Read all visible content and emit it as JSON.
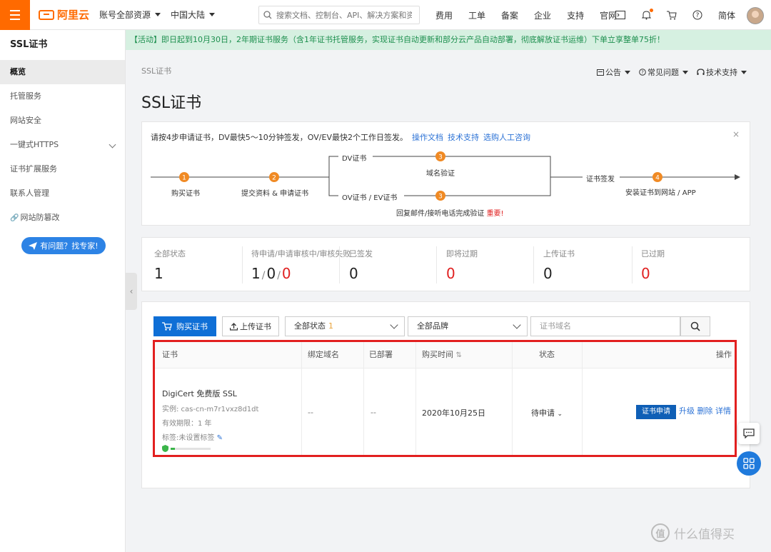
{
  "topbar": {
    "logo_text": "阿里云",
    "account_scope": "账号全部资源",
    "region": "中国大陆",
    "search_placeholder": "搜索文档、控制台、API、解决方案和资源",
    "links": [
      "费用",
      "工单",
      "备案",
      "企业",
      "支持",
      "官网"
    ],
    "lang": "简体"
  },
  "banner": "【活动】即日起到10月30日，2年期证书服务（含1年证书托管服务，实现证书自动更新和部分云产品自动部署，彻底解放证书运维）下单立享整单75折！",
  "sidebar": {
    "title": "SSL证书",
    "items": [
      {
        "label": "概览",
        "active": true
      },
      {
        "label": "托管服务"
      },
      {
        "label": "网站安全"
      },
      {
        "label": "一键式HTTPS",
        "expandable": true
      },
      {
        "label": "证书扩展服务"
      },
      {
        "label": "联系人管理"
      },
      {
        "label": "网站防篡改",
        "icon": "link-icon"
      }
    ],
    "help_button": "有问题？找专家!"
  },
  "breadcrumb": "SSL证书",
  "page_title": "SSL证书",
  "header_links": [
    "公告",
    "常见问题",
    "技术支持"
  ],
  "steps": {
    "tip_text": "请按4步申请证书，DV最快5～10分钟签发，OV/EV最快2个工作日签发。",
    "tip_links": [
      "操作文档",
      "技术支持",
      "选购人工咨询"
    ],
    "labels": {
      "s1": "购买证书",
      "s2": "提交资料 & 申请证书",
      "dv": "DV证书",
      "ov": "OV证书 / EV证书",
      "s3": "域名验证",
      "s3b": "回复邮件/接听电话完成验证",
      "important": "重要!",
      "issue": "证书签发",
      "s4": "安装证书到网站 / APP"
    },
    "numbers": [
      "1",
      "2",
      "3",
      "3",
      "4"
    ]
  },
  "stats": [
    {
      "label": "全部状态",
      "value": "1"
    },
    {
      "label": "待申请/申请审核中/审核失败",
      "values": [
        "1",
        "0",
        "0"
      ]
    },
    {
      "label": "已签发",
      "value": "0"
    },
    {
      "label": "即将过期",
      "value": "0",
      "red": true
    },
    {
      "label": "上传证书",
      "value": "0"
    },
    {
      "label": "已过期",
      "value": "0",
      "red": true
    }
  ],
  "toolbar": {
    "buy_label": "购买证书",
    "upload_label": "上传证书",
    "status_select": "全部状态",
    "status_count": "1",
    "brand_select": "全部品牌",
    "domain_placeholder": "证书域名"
  },
  "table": {
    "headers": [
      "证书",
      "绑定域名",
      "已部署",
      "购买时间",
      "状态",
      "操作"
    ],
    "row": {
      "name": "DigiCert 免费版 SSL",
      "instance": "实例: cas-cn-m7r1vxz8d1dt",
      "validity": "有效期限：1 年",
      "tag": "标签:未设置标签",
      "domain": "--",
      "deployed": "--",
      "purchase_time": "2020年10月25日",
      "status": "待申请",
      "actions": [
        "证书申请",
        "升级",
        "删除",
        "详情"
      ]
    }
  },
  "watermark": "什么值得买",
  "watermark_icon": "值"
}
